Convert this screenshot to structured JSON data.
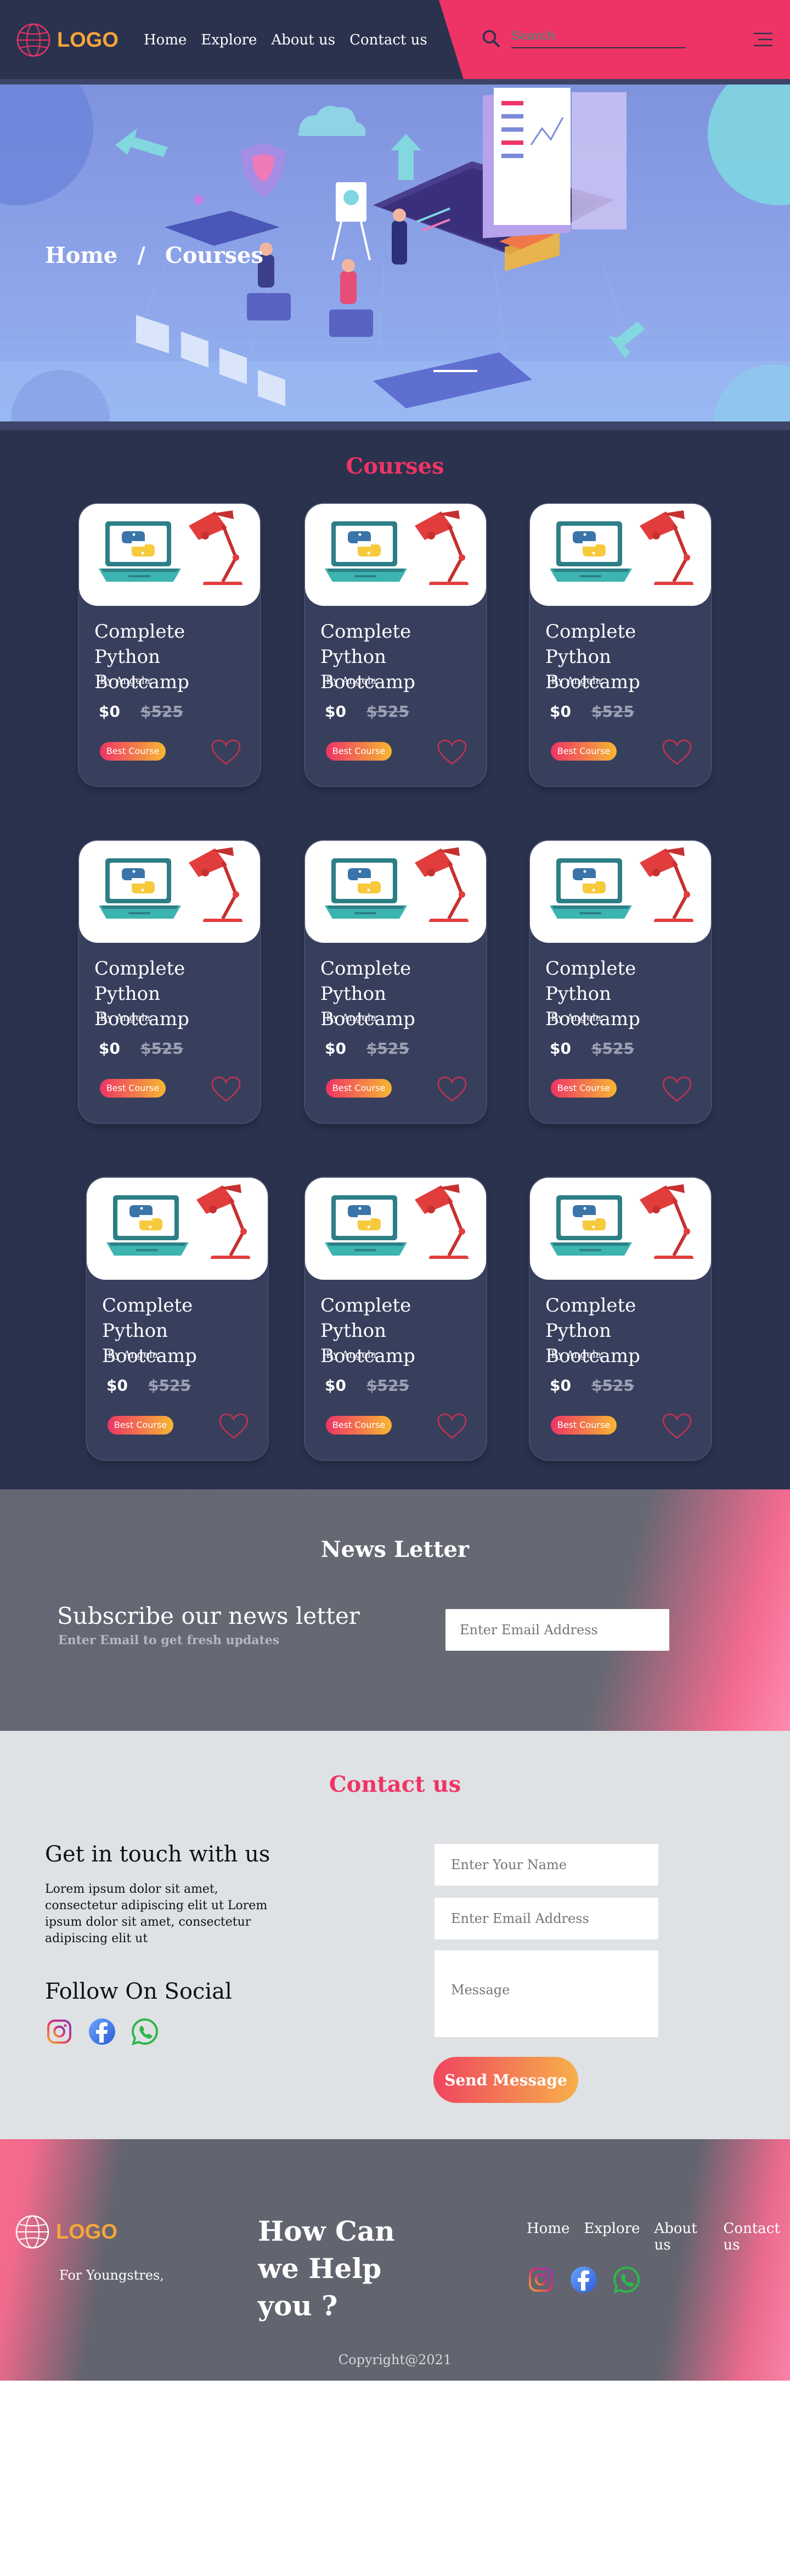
{
  "nav": {
    "logo_text": "LOGO",
    "links": [
      "Home",
      "Explore",
      "About us",
      "Contact us"
    ],
    "search_placeholder": "Search",
    "icons": {
      "logo": "globe-icon",
      "search": "search-icon",
      "menu": "hamburger-menu-icon"
    }
  },
  "hero": {
    "breadcrumb": {
      "home": "Home",
      "separator": "/",
      "current": "Courses"
    }
  },
  "courses": {
    "title": "Courses",
    "items": [
      {
        "title": "Complete Python Bootcamp",
        "author": "By Angela",
        "price": "$0",
        "old_price": "$525",
        "badge": "Best Course"
      },
      {
        "title": "Complete Python Bootcamp",
        "author": "By Angela",
        "price": "$0",
        "old_price": "$525",
        "badge": "Best Course"
      },
      {
        "title": "Complete Python Bootcamp",
        "author": "By Angela",
        "price": "$0",
        "old_price": "$525",
        "badge": "Best Course"
      },
      {
        "title": "Complete Python Bootcamp",
        "author": "By Angela",
        "price": "$0",
        "old_price": "$525",
        "badge": "Best Course"
      },
      {
        "title": "Complete Python Bootcamp",
        "author": "By Angela",
        "price": "$0",
        "old_price": "$525",
        "badge": "Best Course"
      },
      {
        "title": "Complete Python Bootcamp",
        "author": "By Angela",
        "price": "$0",
        "old_price": "$525",
        "badge": "Best Course"
      },
      {
        "title": "Complete Python Bootcamp",
        "author": "By Angela",
        "price": "$0",
        "old_price": "$525",
        "badge": "Best Course"
      },
      {
        "title": "Complete Python Bootcamp",
        "author": "By Angela",
        "price": "$0",
        "old_price": "$525",
        "badge": "Best Course"
      },
      {
        "title": "Complete Python Bootcamp",
        "author": "By Angela",
        "price": "$0",
        "old_price": "$525",
        "badge": "Best Course"
      }
    ]
  },
  "newsletter": {
    "title": "News Letter",
    "heading": "Subscribe our news letter",
    "subheading": "Enter Email to get fresh updates",
    "email_placeholder": "Enter Email Address"
  },
  "contact": {
    "title": "Contact us",
    "heading": "Get in touch with us",
    "body": "Lorem ipsum dolor sit amet, consectetur adipiscing elit ut Lorem ipsum dolor sit amet, consectetur adipiscing elit ut",
    "follow_heading": "Follow On Social",
    "social": [
      "instagram-icon",
      "facebook-icon",
      "whatsapp-icon"
    ],
    "name_placeholder": "Enter Your Name",
    "email_placeholder": "Enter Email Address",
    "message_placeholder": "Message",
    "send_label": "Send Message"
  },
  "footer": {
    "logo_text": "LOGO",
    "tagline": "For Youngstres,",
    "help_text": "How Can we Help you ?",
    "links": [
      "Home",
      "Explore",
      "About us",
      "Contact us"
    ],
    "copyright": "Copyright@2021"
  },
  "colors": {
    "navy": "#2b324e",
    "pink": "#ee3465",
    "orange": "#f7a63b",
    "grey": "#666873",
    "light": "#dfe2e4"
  }
}
